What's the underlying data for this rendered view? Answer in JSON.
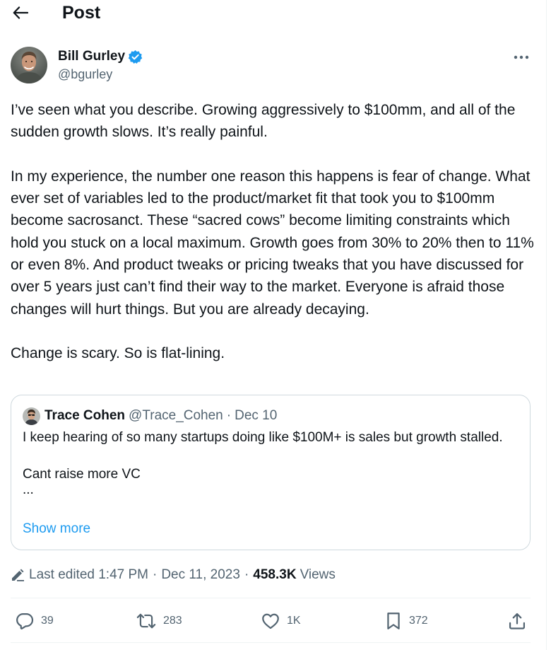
{
  "header": {
    "title": "Post",
    "back_icon": "arrow-left-icon"
  },
  "author": {
    "name": "Bill Gurley",
    "handle": "@bgurley",
    "verified": true,
    "verified_color": "#1d9bf0"
  },
  "post": {
    "paragraphs": [
      "I’ve seen what you describe. Growing aggressively to $100mm, and all of the sudden growth slows. It’s really painful.",
      "In my experience, the number one reason this happens is fear of change. What ever set of variables led to the product/market fit that took you to $100mm become sacrosanct. These “sacred cows” become limiting constraints which hold you stuck on a local maximum. Growth goes from 30% to 20% then to 11% or even 8%. And product tweaks or pricing tweaks that you have discussed for over 5 years just can’t find their way to the market. Everyone is afraid those changes will hurt things. But you are already decaying.",
      "Change is scary. So is flat-lining."
    ]
  },
  "quote": {
    "name": "Trace Cohen",
    "handle": "@Trace_Cohen",
    "separator": "·",
    "date": "Dec 10",
    "line1": "I keep hearing of so many startups doing like $100M+ is sales but growth stalled.",
    "line2": "Cant raise more VC",
    "ellipsis": "...",
    "show_more": "Show more"
  },
  "meta": {
    "edited": "Last edited 1:47 PM",
    "separator": "·",
    "date": "Dec 11, 2023",
    "views_count": "458.3K",
    "views_label": "Views"
  },
  "actions": {
    "replies": "39",
    "reposts": "283",
    "likes": "1K",
    "bookmarks": "372"
  },
  "colors": {
    "text": "#0f1419",
    "secondary": "#536471",
    "accent": "#1d9bf0",
    "border": "#cfd9de",
    "divider": "#eff3f4"
  }
}
